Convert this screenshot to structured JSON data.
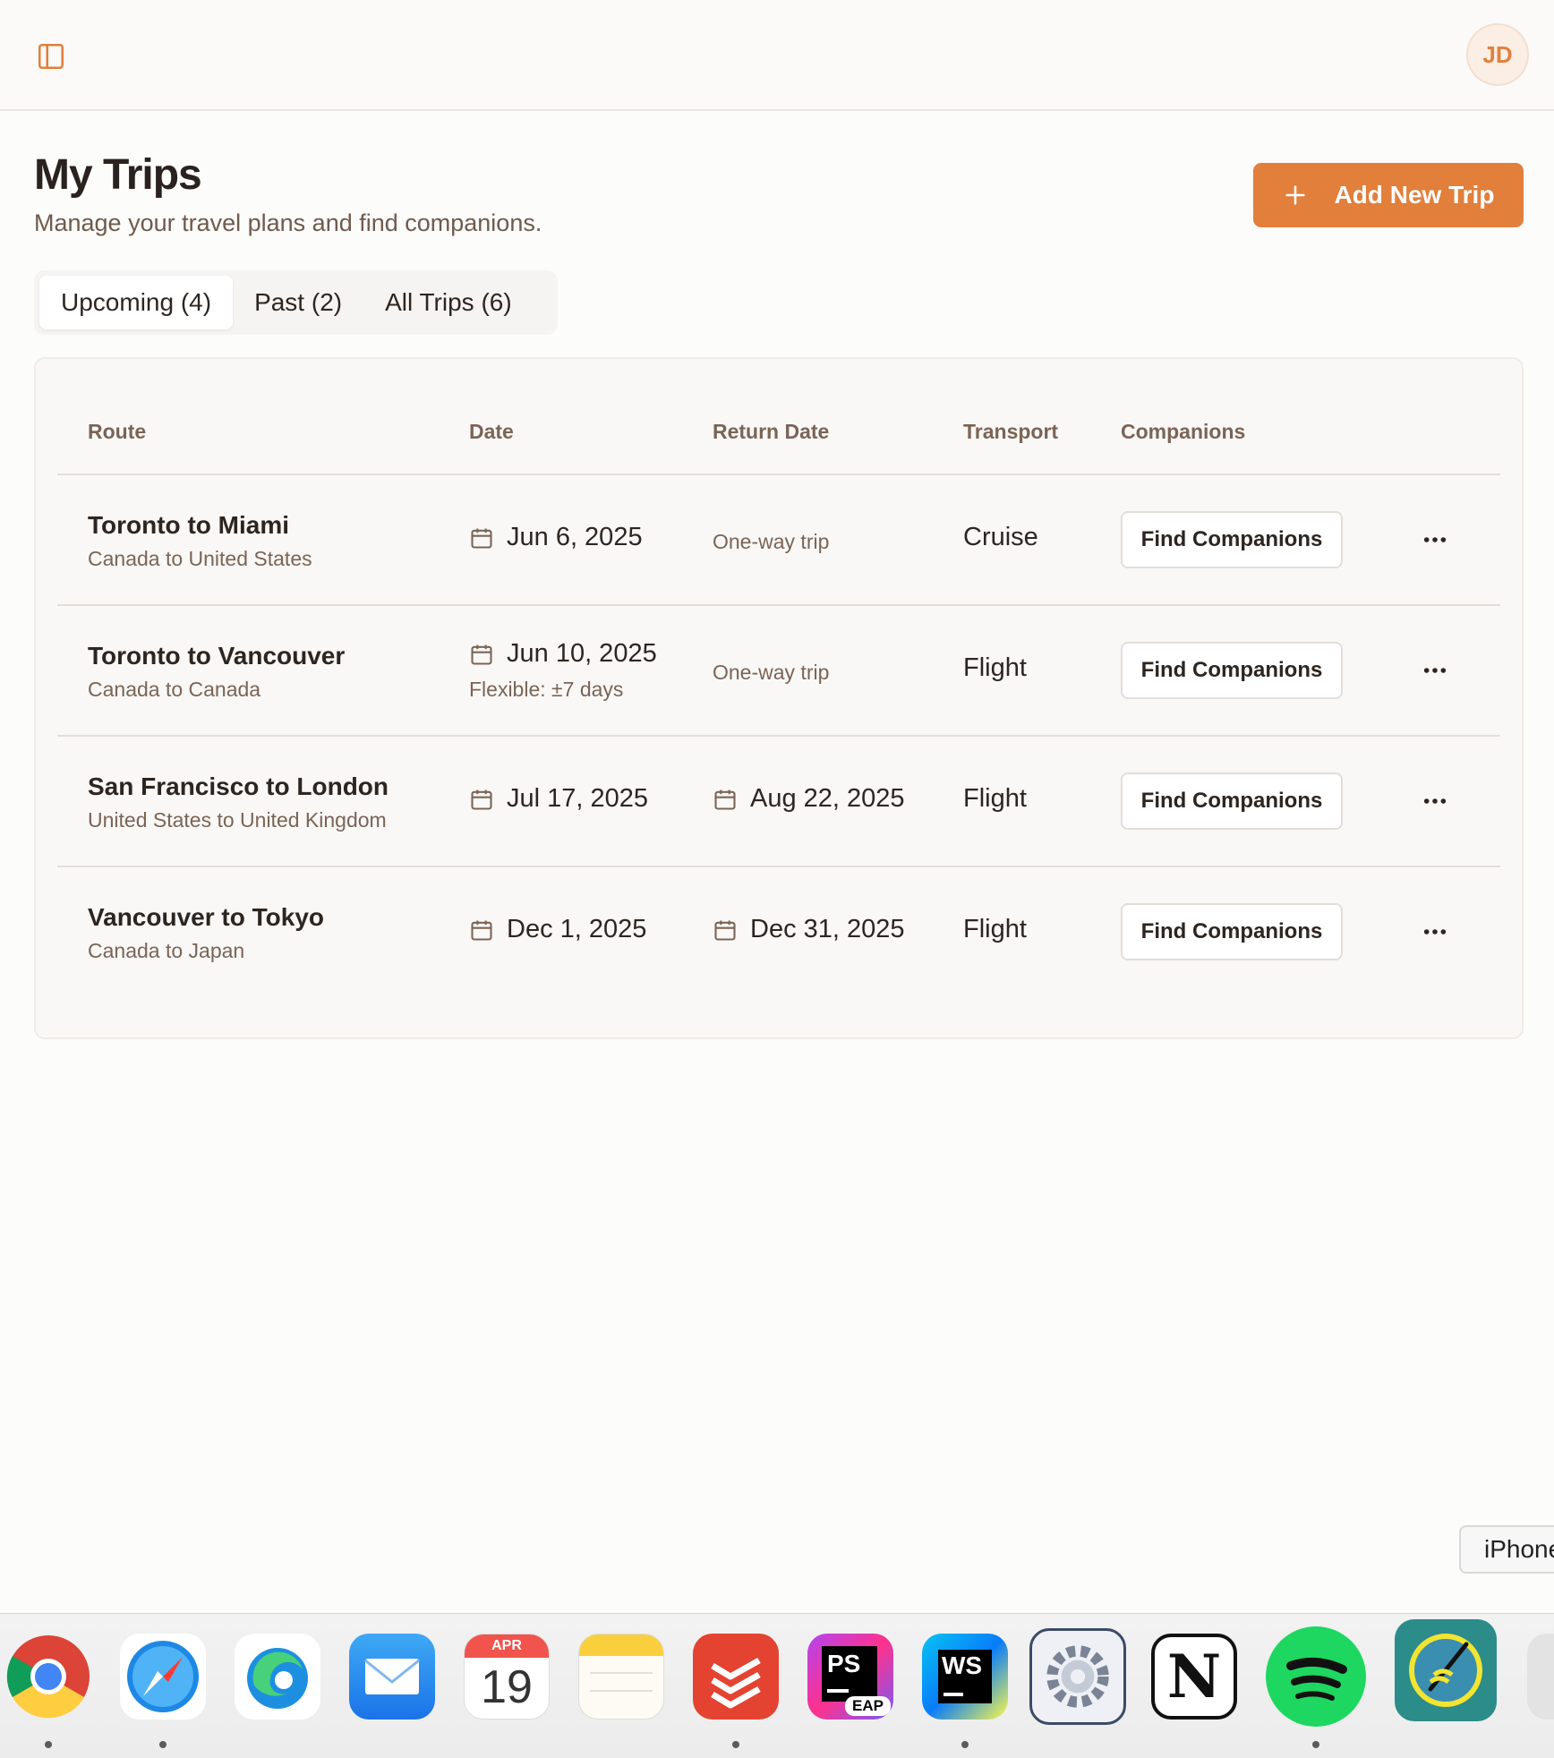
{
  "header": {
    "avatar_initials": "JD"
  },
  "page": {
    "title": "My Trips",
    "subtitle": "Manage your travel plans and find companions.",
    "add_button_label": "Add New Trip"
  },
  "tabs": [
    {
      "label": "Upcoming (4)",
      "active": true
    },
    {
      "label": "Past (2)",
      "active": false
    },
    {
      "label": "All Trips (6)",
      "active": false
    }
  ],
  "table": {
    "columns": [
      "Route",
      "Date",
      "Return Date",
      "Transport",
      "Companions"
    ],
    "rows": [
      {
        "route": "Toronto to Miami",
        "countries": "Canada to United States",
        "date": "Jun 6, 2025",
        "flexible": "",
        "return": "One-way trip",
        "transport": "Cruise",
        "action": "Find Companions"
      },
      {
        "route": "Toronto to Vancouver",
        "countries": "Canada to Canada",
        "date": "Jun 10, 2025",
        "flexible": "Flexible: ±7 days",
        "return": "One-way trip",
        "transport": "Flight",
        "action": "Find Companions"
      },
      {
        "route": "San Francisco to London",
        "countries": "United States to United Kingdom",
        "date": "Jul 17, 2025",
        "flexible": "",
        "return": "Aug 22, 2025",
        "transport": "Flight",
        "action": "Find Companions"
      },
      {
        "route": "Vancouver to Tokyo",
        "countries": "Canada to Japan",
        "date": "Dec 1, 2025",
        "flexible": "",
        "return": "Dec 31, 2025",
        "transport": "Flight",
        "action": "Find Companions"
      }
    ]
  },
  "toast": {
    "text": "iPhone"
  },
  "dock": {
    "calendar_month": "APR",
    "calendar_day": "19",
    "phpstorm_label": "PS",
    "phpstorm_badge": "EAP",
    "webstorm_label": "WS",
    "notion_label": "N"
  },
  "colors": {
    "accent": "#e27f3b",
    "muted_text": "#7b6455",
    "border": "#e4ddd7"
  }
}
